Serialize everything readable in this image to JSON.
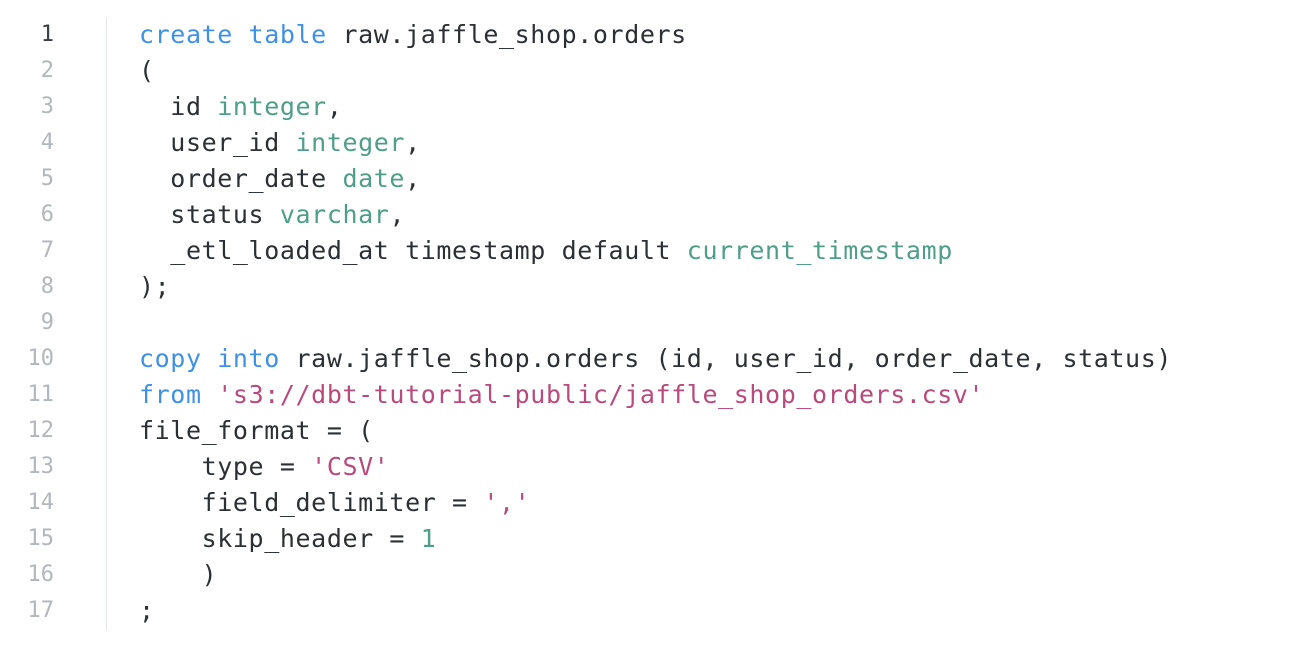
{
  "editor": {
    "language": "sql",
    "active_line": 1,
    "colors": {
      "keyword": "#3f91e6",
      "type": "#4f9e88",
      "string": "#b94a7b",
      "number": "#4f9e88",
      "plain": "#2c2f33",
      "line_number": "#b3b6bb",
      "line_number_active": "#3a3d42"
    },
    "lines": [
      {
        "number": "1",
        "tokens": [
          {
            "t": "keyword",
            "v": "create table"
          },
          {
            "t": "plain",
            "v": " raw.jaffle_shop.orders"
          }
        ]
      },
      {
        "number": "2",
        "tokens": [
          {
            "t": "plain",
            "v": "("
          }
        ]
      },
      {
        "number": "3",
        "tokens": [
          {
            "t": "plain",
            "v": "  id "
          },
          {
            "t": "type",
            "v": "integer"
          },
          {
            "t": "plain",
            "v": ","
          }
        ]
      },
      {
        "number": "4",
        "tokens": [
          {
            "t": "plain",
            "v": "  user_id "
          },
          {
            "t": "type",
            "v": "integer"
          },
          {
            "t": "plain",
            "v": ","
          }
        ]
      },
      {
        "number": "5",
        "tokens": [
          {
            "t": "plain",
            "v": "  order_date "
          },
          {
            "t": "type",
            "v": "date"
          },
          {
            "t": "plain",
            "v": ","
          }
        ]
      },
      {
        "number": "6",
        "tokens": [
          {
            "t": "plain",
            "v": "  status "
          },
          {
            "t": "type",
            "v": "varchar"
          },
          {
            "t": "plain",
            "v": ","
          }
        ]
      },
      {
        "number": "7",
        "tokens": [
          {
            "t": "plain",
            "v": "  _etl_loaded_at timestamp default "
          },
          {
            "t": "type",
            "v": "current_timestamp"
          }
        ]
      },
      {
        "number": "8",
        "tokens": [
          {
            "t": "plain",
            "v": ");"
          }
        ]
      },
      {
        "number": "9",
        "tokens": []
      },
      {
        "number": "10",
        "tokens": [
          {
            "t": "keyword",
            "v": "copy into"
          },
          {
            "t": "plain",
            "v": " raw.jaffle_shop.orders (id, user_id, order_date, status)"
          }
        ]
      },
      {
        "number": "11",
        "tokens": [
          {
            "t": "keyword",
            "v": "from"
          },
          {
            "t": "plain",
            "v": " "
          },
          {
            "t": "string",
            "v": "'s3://dbt-tutorial-public/jaffle_shop_orders.csv'"
          }
        ]
      },
      {
        "number": "12",
        "tokens": [
          {
            "t": "plain",
            "v": "file_format = ("
          }
        ]
      },
      {
        "number": "13",
        "tokens": [
          {
            "t": "plain",
            "v": "    type = "
          },
          {
            "t": "string",
            "v": "'CSV'"
          }
        ]
      },
      {
        "number": "14",
        "tokens": [
          {
            "t": "plain",
            "v": "    field_delimiter = "
          },
          {
            "t": "string",
            "v": "','"
          }
        ]
      },
      {
        "number": "15",
        "tokens": [
          {
            "t": "plain",
            "v": "    skip_header = "
          },
          {
            "t": "number",
            "v": "1"
          }
        ]
      },
      {
        "number": "16",
        "tokens": [
          {
            "t": "plain",
            "v": "    )"
          }
        ]
      },
      {
        "number": "17",
        "tokens": [
          {
            "t": "plain",
            "v": ";"
          }
        ]
      }
    ]
  }
}
